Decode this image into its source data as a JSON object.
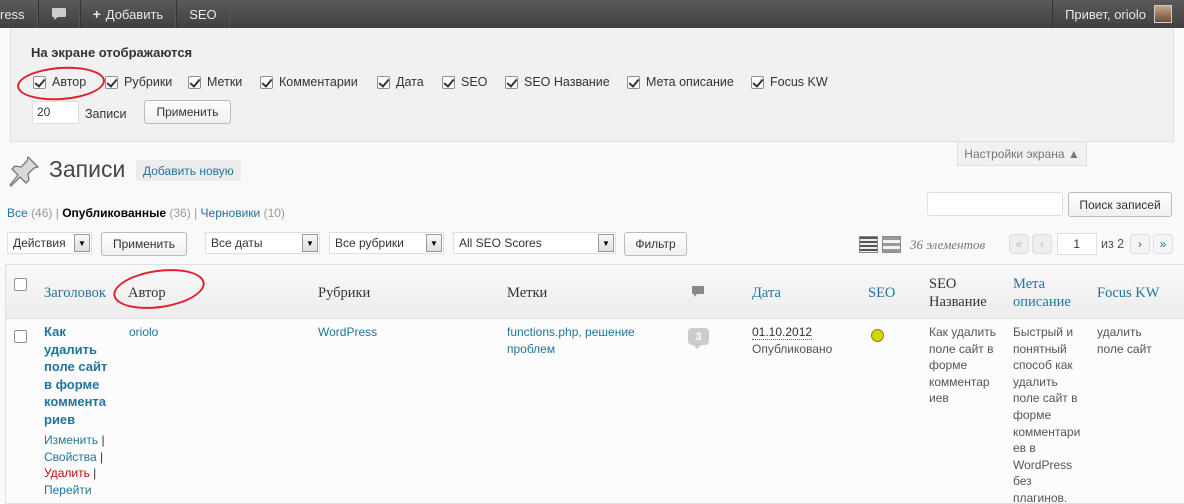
{
  "admin_bar": {
    "site_label": "ress",
    "add_label": "Добавить",
    "seo_label": "SEO",
    "greeting": "Привет, oriolo"
  },
  "screen_options": {
    "title": "На экране отображаются",
    "columns": [
      {
        "label": "Автор",
        "checked": true
      },
      {
        "label": "Рубрики",
        "checked": true
      },
      {
        "label": "Метки",
        "checked": true
      },
      {
        "label": "Комментарии",
        "checked": true
      },
      {
        "label": "Дата",
        "checked": true
      },
      {
        "label": "SEO",
        "checked": true
      },
      {
        "label": "SEO Название",
        "checked": true
      },
      {
        "label": "Мета описание",
        "checked": true
      },
      {
        "label": "Focus KW",
        "checked": true
      }
    ],
    "per_page": "20",
    "per_page_label": "Записи",
    "apply_label": "Применить",
    "tab_label": "Настройки экрана ▲"
  },
  "page": {
    "title": "Записи",
    "add_new": "Добавить новую"
  },
  "filters": {
    "all": "Все",
    "all_count": "(46)",
    "published": "Опубликованные",
    "published_count": "(36)",
    "drafts": "Черновики",
    "drafts_count": "(10)",
    "separator": "|"
  },
  "search": {
    "value": "",
    "button": "Поиск записей"
  },
  "tablenav": {
    "bulk_actions": "Действия",
    "bulk_apply": "Применить",
    "dates": "Все даты",
    "categories": "Все рубрики",
    "seo_scores": "All SEO Scores",
    "filter_button": "Фильтр",
    "displaying": "36 элементов",
    "first": "«",
    "prev": "‹",
    "current_page": "1",
    "of_pages": "из 2",
    "next": "›",
    "last": "»"
  },
  "columns": {
    "title": "Заголовок",
    "author": "Автор",
    "categories": "Рубрики",
    "tags": "Метки",
    "date": "Дата",
    "seo": "SEO",
    "seo_title_1": "SEO",
    "seo_title_2": "Название",
    "meta_1": "Мета",
    "meta_2": "описание",
    "focus": "Focus KW"
  },
  "post": {
    "title_lines": [
      "Как",
      "удалить",
      "поле сайт",
      "в форме",
      "коммента",
      "риев"
    ],
    "actions": {
      "edit": "Изменить",
      "quick_edit": "Свойства",
      "trash": "Удалить",
      "view": "Перейти",
      "sep": "|"
    },
    "author": "oriolo",
    "category": "WordPress",
    "tags_line1": "functions.php, решение",
    "tags_line2": "проблем",
    "comments": "3",
    "date": "01.10.2012",
    "status": "Опубликовано",
    "seo_score_color": "#d4d400",
    "seo_title_lines": [
      "Как удалить",
      "поле сайт в",
      "форме",
      "комментар",
      "иев"
    ],
    "meta_lines": [
      "Быстрый и",
      "понятный",
      "способ как",
      "удалить",
      "поле сайт в",
      "форме",
      "комментари",
      "ев в",
      "WordPress",
      "без",
      "плагинов."
    ],
    "focus_lines": [
      "удалить",
      "поле сайт"
    ]
  }
}
